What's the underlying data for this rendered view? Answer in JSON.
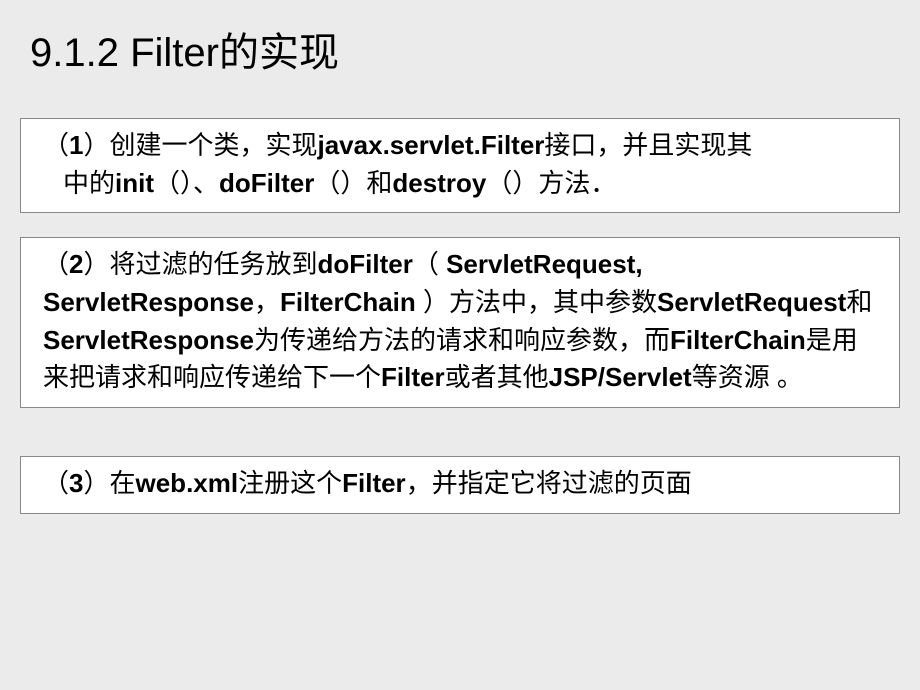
{
  "title": "9.1.2 Filter的实现",
  "point1": {
    "prefix": "（",
    "num": "1",
    "text1": "）创建一个类，实现",
    "bold1": "javax.servlet.Filter",
    "text2": "接口，并且实现其",
    "line2a": "中的",
    "bold2": "init",
    "paren1": "（）、",
    "bold3": "doFilter",
    "paren2": "（）和",
    "bold4": "destroy",
    "paren3": "（）方法．"
  },
  "point2": {
    "prefix": "（",
    "num": "2",
    "text1": "）将过滤的任务放到",
    "bold1": "doFilter",
    "paren_open": "（ ",
    "bold2": "ServletRequest, ServletResponse",
    "comma": "，",
    "bold3": "FilterChain ",
    "paren_close": "）方法中，其中参数",
    "bold4": "ServletRequest",
    "text_and": "和",
    "bold5": "ServletResponse",
    "text2": "为传递给方法的请求和响应参数，而",
    "bold6": "FilterChain",
    "text3": "是用来把请求和响应传递给下一个",
    "bold7": "Filter",
    "text4": "或者其他",
    "bold8": "JSP/Servlet",
    "text5": "等资源 。"
  },
  "point3": {
    "prefix": "（",
    "num": "3",
    "text1": "）在",
    "bold1": "web.xml",
    "text2": "注册这个",
    "bold2": "Filter",
    "text3": "，并指定它将过滤的页面"
  }
}
